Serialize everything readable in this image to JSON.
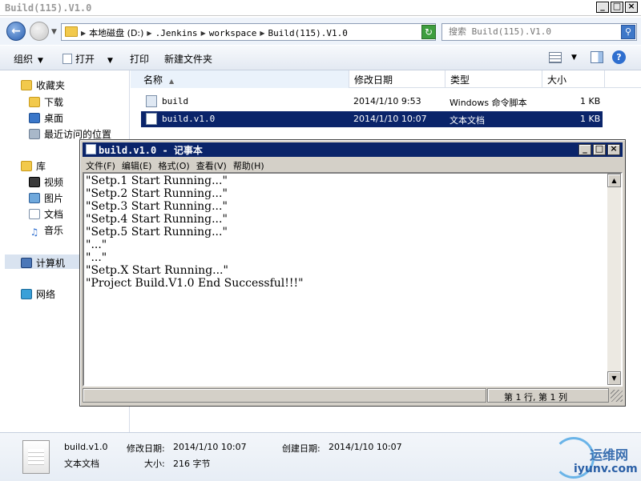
{
  "explorer": {
    "title": "Build(115).V1.0",
    "window_buttons": [
      "_",
      "□",
      "×"
    ],
    "breadcrumb": [
      "本地磁盘 (D:)",
      ".Jenkins",
      "workspace",
      "Build(115).V1.0"
    ],
    "search": {
      "placeholder": "搜索 Build(115).V1.0"
    },
    "toolbar": {
      "organize": "组织",
      "open": "打开",
      "print": "打印",
      "new_folder": "新建文件夹"
    },
    "nav": {
      "favorites": "收藏夹",
      "downloads": "下载",
      "desktop": "桌面",
      "recent": "最近访问的位置",
      "libraries": "库",
      "videos": "视频",
      "pictures": "图片",
      "documents": "文档",
      "music": "音乐",
      "computer": "计算机",
      "network": "网络"
    },
    "columns": {
      "name": "名称",
      "modified": "修改日期",
      "type": "类型",
      "size": "大小"
    },
    "files": [
      {
        "name": "build",
        "modified": "2014/1/10 9:53",
        "type": "Windows 命令脚本",
        "size": "1 KB"
      },
      {
        "name": "build.v1.0",
        "modified": "2014/1/10 10:07",
        "type": "文本文档",
        "size": "1 KB"
      }
    ],
    "details": {
      "filename": "build.v1.0",
      "type": "文本文档",
      "modified_label": "修改日期:",
      "modified": "2014/1/10 10:07",
      "created_label": "创建日期:",
      "created": "2014/1/10 10:07",
      "size_label": "大小:",
      "size": "216 字节"
    },
    "watermark": {
      "cn": "运维网",
      "en": "iyunv.com"
    }
  },
  "notepad": {
    "title": "build.v1.0 - 记事本",
    "menu": [
      "文件(F)",
      "编辑(E)",
      "格式(O)",
      "查看(V)",
      "帮助(H)"
    ],
    "content": "\"Setp.1 Start Running...\"\n\"Setp.2 Start Running...\"\n\"Setp.3 Start Running...\"\n\"Setp.4 Start Running...\"\n\"Setp.5 Start Running...\"\n\"...\"\n\"...\"\n\"Setp.X Start Running...\"\n\"Project Build.V1.0 End Successful!!!\"",
    "status": "第 1 行, 第 1 列"
  }
}
